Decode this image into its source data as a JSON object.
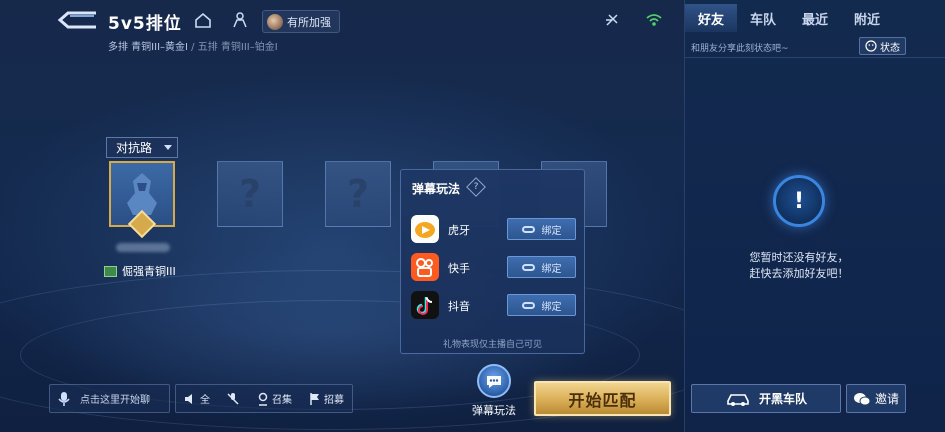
{
  "header": {
    "title": "5v5排位",
    "team_status": "有所加强",
    "queue_info_main": "多排 青铜III–黄金I",
    "queue_info_sep": " / ",
    "queue_info_alt": "五排 青铜III–铂金I"
  },
  "lobby": {
    "role_select": "对抗路",
    "player_rank": "倔强青铜III",
    "empty_slot_symbol": "?"
  },
  "danmaku_popup": {
    "title": "弹幕玩法",
    "help_symbol": "?",
    "platforms": [
      {
        "name": "虎牙",
        "bind_label": "绑定",
        "color": "#f5a623"
      },
      {
        "name": "快手",
        "bind_label": "绑定",
        "color": "#ff5a1f"
      },
      {
        "name": "抖音",
        "bind_label": "绑定",
        "color": "#111111"
      }
    ],
    "note": "礼物表现仅主播自己可见"
  },
  "bottom_bar": {
    "chat_prompt": "点击这里开始聊",
    "vol_label": "全",
    "summon_label": "召集",
    "recruit_label": "招募",
    "danmaku_label": "弹幕玩法",
    "start_label": "开始匹配"
  },
  "friends_panel": {
    "tabs": [
      "好友",
      "车队",
      "最近",
      "附近"
    ],
    "active_tab": "好友",
    "status_hint": "和朋友分享此刻状态吧~",
    "status_button": "状态",
    "empty_icon_symbol": "!",
    "empty_line1": "您暂时还没有好友，",
    "empty_line2": "赶快去添加好友吧！",
    "carteam_button": "开黑车队",
    "invite_button": "邀请"
  },
  "colors": {
    "accent_gold": "#d6a94a",
    "panel_blue": "#132a4f",
    "bind_blue": "#3f6db0"
  }
}
